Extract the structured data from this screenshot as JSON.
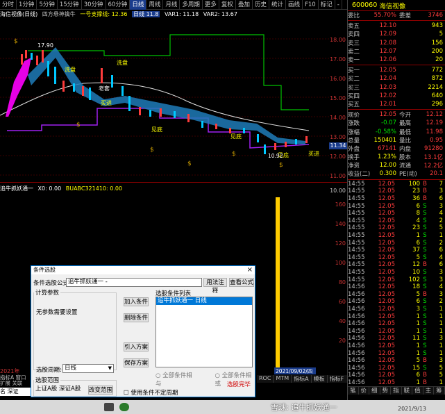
{
  "toolbar": {
    "items": [
      "分时",
      "1分钟",
      "5分钟",
      "15分钟",
      "30分钟",
      "60分钟",
      "日线",
      "周线",
      "月线",
      "多周期",
      "更多"
    ],
    "active_index": 6,
    "right_items": [
      "复权",
      "叠加",
      "历史",
      "统计",
      "画线",
      "F10",
      "标记",
      "-"
    ]
  },
  "chart": {
    "title": "海信视像(日线)",
    "indicator_text": "四方悬神擒牛",
    "line_name": "一号支撑线: 12.36",
    "mid_text": "日线 11.8",
    "var1": "VAR1: 11.18",
    "var2": "VAR2: 13.67",
    "labels": {
      "high": "17.90",
      "wash1": "洗盘",
      "wash2": "洗盘",
      "buy1": "买进",
      "see_bottom1": "见底",
      "see_bottom2": "见底",
      "see_bottom3": "见底",
      "buy2": "买进",
      "pressure": "老套",
      "low": "10.92"
    },
    "price_ticks": [
      "18.00",
      "17.00",
      "16.00",
      "15.00",
      "14.00",
      "13.00",
      "12.00",
      "11.00",
      "10.00"
    ],
    "last_price_tag": "11.34"
  },
  "indicator": {
    "title": "追牛抓妖通一",
    "values": "X0: 0.00",
    "extra": "BUABC321410: 0.00",
    "scale": [
      "160",
      "140",
      "120",
      "100",
      "80",
      "60",
      "40",
      "20"
    ],
    "date_tag": "2021/09/02/四",
    "year": "2021年"
  },
  "status_tabs": [
    "ROC",
    "MTM",
    "指标A",
    "模板",
    "指标F",
    "扩展"
  ],
  "right_panel": {
    "code": "600060",
    "name": "海信视像",
    "weibi_label": "委比",
    "weibi_value": "55.70%",
    "weicha_label": "委差",
    "weicha_value": "3746",
    "sells": [
      {
        "label": "卖五",
        "price": "12.10",
        "qty": "943"
      },
      {
        "label": "卖四",
        "price": "12.09",
        "qty": "5"
      },
      {
        "label": "卖三",
        "price": "12.08",
        "qty": "156"
      },
      {
        "label": "卖二",
        "price": "12.07",
        "qty": "200"
      },
      {
        "label": "卖一",
        "price": "12.06",
        "qty": "20"
      }
    ],
    "buys": [
      {
        "label": "买一",
        "price": "12.05",
        "qty": "772"
      },
      {
        "label": "买二",
        "price": "12.04",
        "qty": "872"
      },
      {
        "label": "买三",
        "price": "12.03",
        "qty": "2214"
      },
      {
        "label": "买四",
        "price": "12.02",
        "qty": "640"
      },
      {
        "label": "买五",
        "price": "12.01",
        "qty": "296"
      }
    ],
    "quote": [
      {
        "l1": "现价",
        "v1": "12.05",
        "l2": "今开",
        "v2": "12.12"
      },
      {
        "l1": "涨跌",
        "v1": "-0.07",
        "l2": "最高",
        "v2": "12.19"
      },
      {
        "l1": "涨幅",
        "v1": "-0.58%",
        "l2": "最低",
        "v2": "11.98"
      },
      {
        "l1": "总量",
        "v1": "150401",
        "l2": "量比",
        "v2": "0.95"
      },
      {
        "l1": "外盘",
        "v1": "67141",
        "l2": "内盘",
        "v2": "91280"
      },
      {
        "l1": "换手",
        "v1": "1.23%",
        "l2": "股本",
        "v2": "13.1亿"
      },
      {
        "l1": "净资",
        "v1": "12.00",
        "l2": "流通",
        "v2": "12.2亿"
      },
      {
        "l1": "收益(二)",
        "v1": "0.300",
        "l2": "PE(动)",
        "v2": "20.1"
      }
    ],
    "ticks": [
      {
        "t": "14:55",
        "p": "12.05",
        "v": "100",
        "f": "B",
        "z": "7"
      },
      {
        "t": "14:55",
        "p": "12.05",
        "v": "23",
        "f": "B",
        "z": "3"
      },
      {
        "t": "14:55",
        "p": "12.05",
        "v": "36",
        "f": "B",
        "z": "6"
      },
      {
        "t": "14:55",
        "p": "12.05",
        "v": "6",
        "f": "S",
        "z": "3"
      },
      {
        "t": "14:55",
        "p": "12.05",
        "v": "8",
        "f": "S",
        "z": "4"
      },
      {
        "t": "14:55",
        "p": "12.05",
        "v": "4",
        "f": "S",
        "z": "2"
      },
      {
        "t": "14:55",
        "p": "12.05",
        "v": "23",
        "f": "S",
        "z": "5"
      },
      {
        "t": "14:55",
        "p": "12.05",
        "v": "1",
        "f": "S",
        "z": "1"
      },
      {
        "t": "14:55",
        "p": "12.05",
        "v": "6",
        "f": "S",
        "z": "2"
      },
      {
        "t": "14:55",
        "p": "12.05",
        "v": "37",
        "f": "S",
        "z": "6"
      },
      {
        "t": "14:55",
        "p": "12.05",
        "v": "5",
        "f": "S",
        "z": "4"
      },
      {
        "t": "14:55",
        "p": "12.05",
        "v": "12",
        "f": "B",
        "z": "6"
      },
      {
        "t": "14:55",
        "p": "12.05",
        "v": "10",
        "f": "S",
        "z": "3"
      },
      {
        "t": "14:55",
        "p": "12.05",
        "v": "102",
        "f": "S",
        "z": "3"
      },
      {
        "t": "14:56",
        "p": "12.05",
        "v": "18",
        "f": "S",
        "z": "4"
      },
      {
        "t": "14:56",
        "p": "12.05",
        "v": "5",
        "f": "B",
        "z": "3"
      },
      {
        "t": "14:56",
        "p": "12.05",
        "v": "6",
        "f": "S",
        "z": "2"
      },
      {
        "t": "14:56",
        "p": "12.05",
        "v": "3",
        "f": "S",
        "z": "1"
      },
      {
        "t": "14:56",
        "p": "12.05",
        "v": "1",
        "f": "S",
        "z": "1"
      },
      {
        "t": "14:56",
        "p": "12.05",
        "v": "1",
        "f": "S",
        "z": "1"
      },
      {
        "t": "14:56",
        "p": "12.05",
        "v": "1",
        "f": "S",
        "z": "1"
      },
      {
        "t": "14:56",
        "p": "12.05",
        "v": "11",
        "f": "S",
        "z": "3"
      },
      {
        "t": "14:56",
        "p": "12.05",
        "v": "1",
        "f": "S",
        "z": "1"
      },
      {
        "t": "14:56",
        "p": "12.05",
        "v": "1",
        "f": "S",
        "z": "1"
      },
      {
        "t": "14:56",
        "p": "12.05",
        "v": "5",
        "f": "B",
        "z": "3"
      },
      {
        "t": "14:56",
        "p": "12.05",
        "v": "15",
        "f": "S",
        "z": "5"
      },
      {
        "t": "14:56",
        "p": "12.05",
        "v": "6",
        "f": "B",
        "z": "5"
      },
      {
        "t": "14:56",
        "p": "12.05",
        "v": "1",
        "f": "B",
        "z": "1"
      },
      {
        "t": "15:00",
        "p": "12.05",
        "v": "1140",
        "f": "",
        "z": "166"
      }
    ],
    "bottom_tabs": [
      "笔",
      "价",
      "细",
      "势",
      "指",
      "联",
      "值",
      "主",
      "筹"
    ]
  },
  "dialog": {
    "title": "条件选股",
    "formula_label": "条件选股公式",
    "formula_value": "追牛抓妖通一 -",
    "btn_formula_note": "用法注释",
    "btn_view_formula": "查看公式",
    "group_params": "计算参数",
    "no_params": "无参数需要设置",
    "btn_add": "加入条件",
    "btn_delete": "删除条件",
    "list_title": "选股条件列表",
    "list_item": "追牛抓妖通一    日线",
    "btn_import": "引入方案",
    "btn_save": "保存方案",
    "period_label": "选股周期:",
    "period_value": "日线",
    "radio_and": "全部条件相与",
    "radio_or": "全部条件相或",
    "done_text": "选股完毕",
    "range_group": "选股范围",
    "range_value": "上证A股  深证A股",
    "btn_change_range": "改变范围",
    "check_label": "使用条件不定周期"
  },
  "left_stub": {
    "a": "指标A",
    "b": "窗口",
    "c": "扩展",
    "d": "关联",
    "e": "名",
    "f": "深证 1470"
  },
  "watermark": {
    "text": "雪球: 追牛抓妖通一",
    "date": "2021/9/13"
  }
}
